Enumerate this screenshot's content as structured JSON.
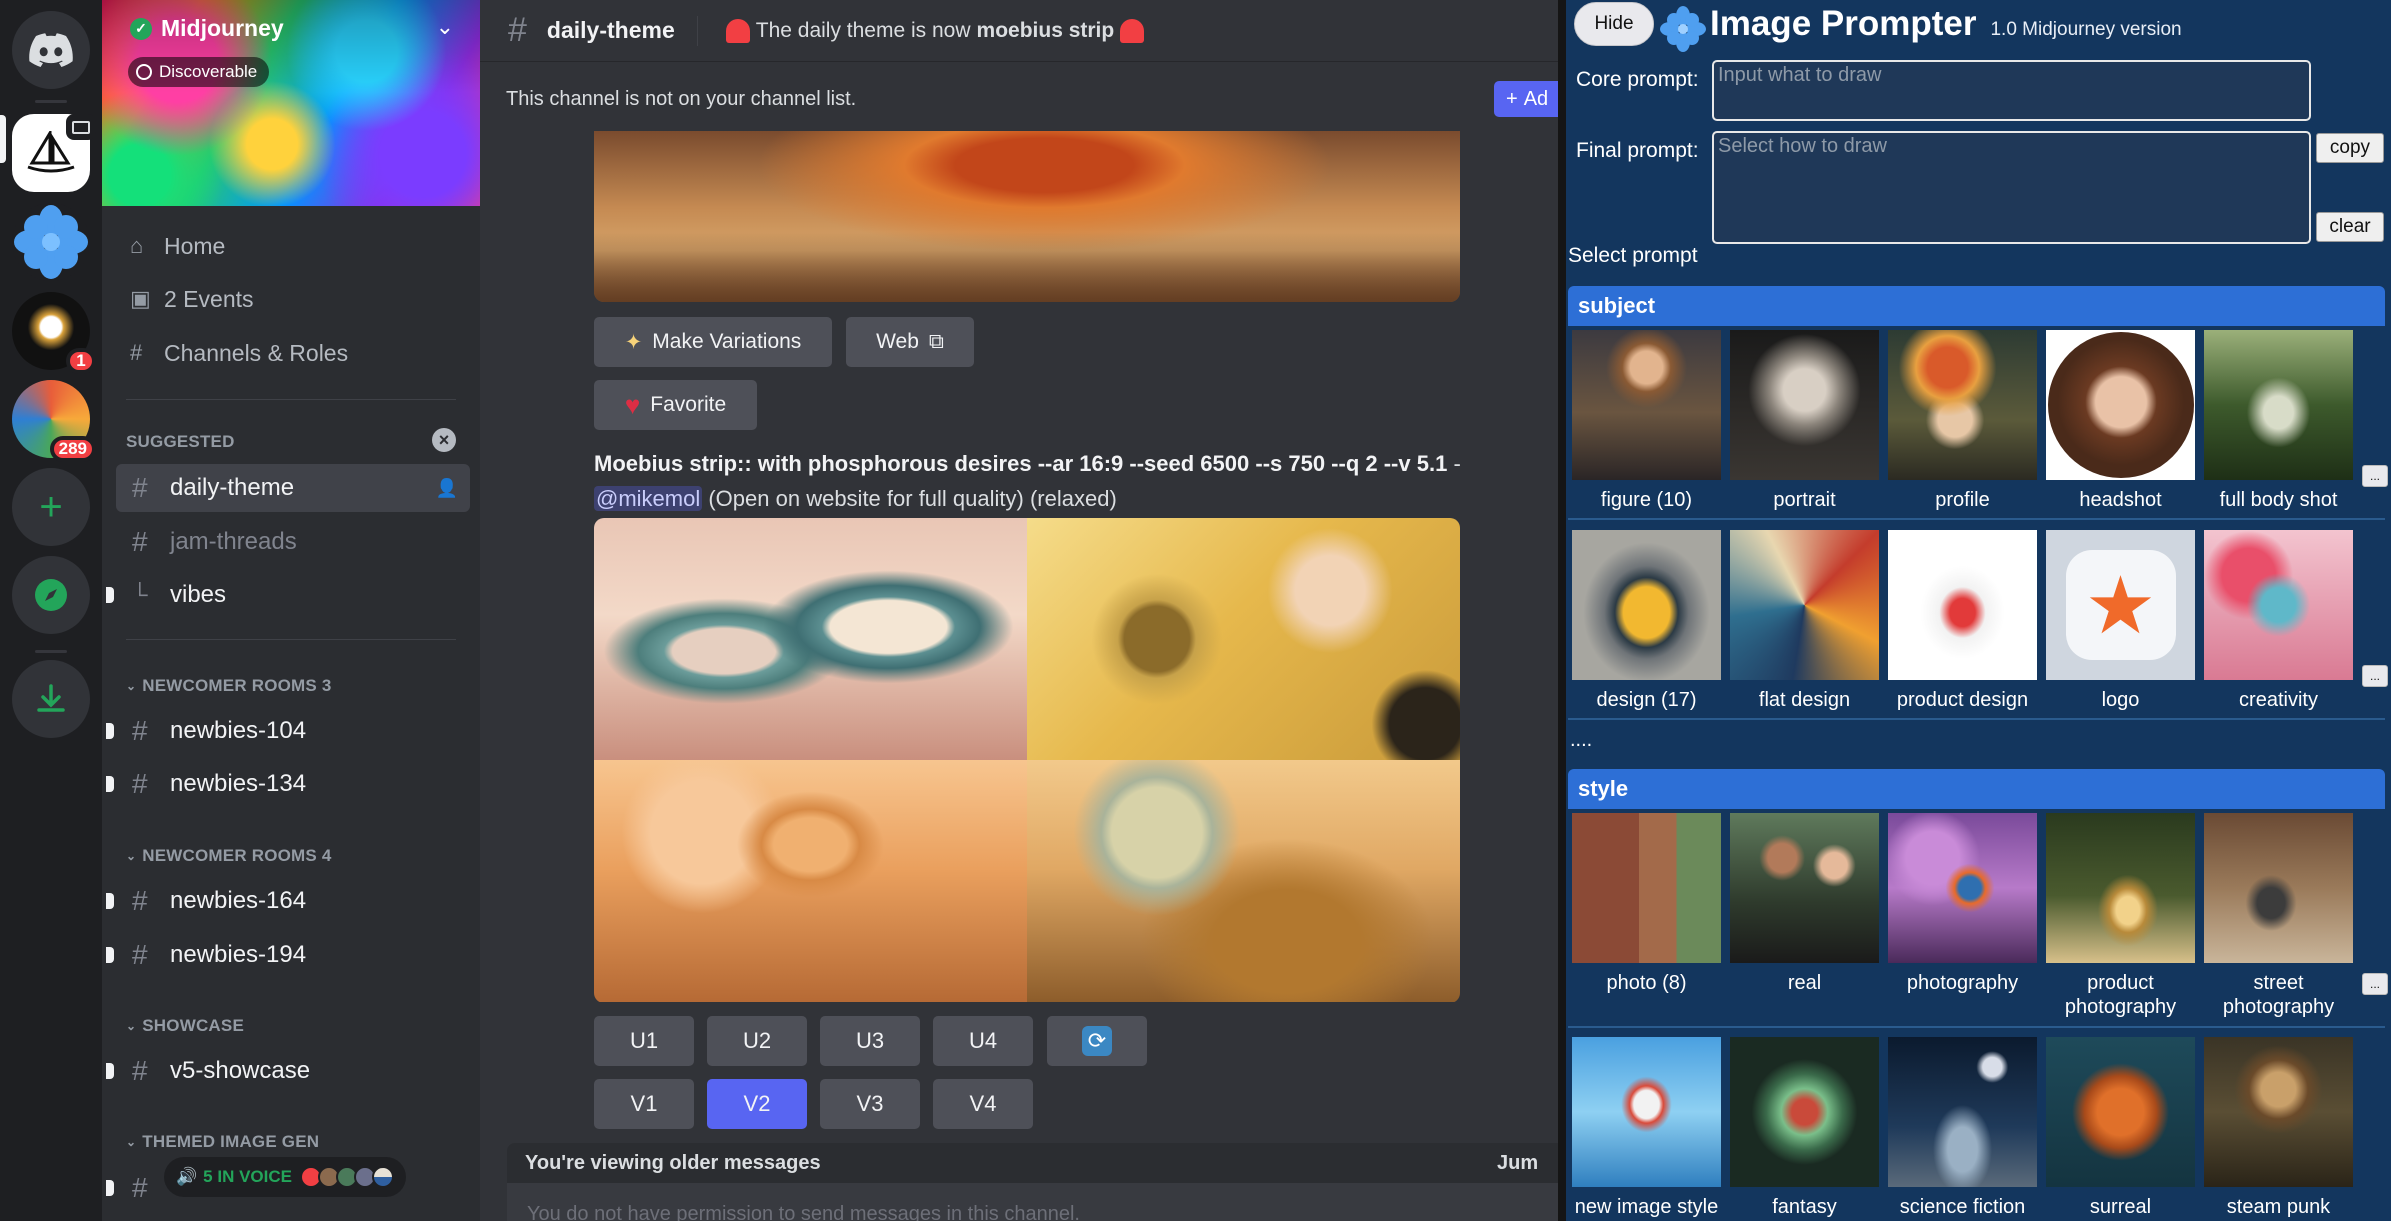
{
  "server": {
    "name": "Midjourney",
    "discoverable": "Discoverable"
  },
  "rail": {
    "badge_1": "1",
    "badge_289": "289"
  },
  "nav": {
    "home": "Home",
    "events": "2 Events",
    "channels_roles": "Channels & Roles"
  },
  "sidebar": {
    "suggested": "SUGGESTED",
    "daily_theme": "daily-theme",
    "jam_threads": "jam-threads",
    "vibes": "vibes",
    "newcomer3": "NEWCOMER ROOMS 3",
    "newbies_104": "newbies-104",
    "newbies_134": "newbies-134",
    "newcomer4": "NEWCOMER ROOMS 4",
    "newbies_164": "newbies-164",
    "newbies_194": "newbies-194",
    "showcase": "SHOWCASE",
    "v5_showcase": "v5-showcase",
    "themed": "THEMED IMAGE GEN",
    "voice": "5 IN VOICE"
  },
  "header": {
    "channel": "daily-theme",
    "topic_prefix": "The daily theme is now",
    "topic_bold": "moebius strip"
  },
  "notice": {
    "text": "This channel is not on your channel list.",
    "add": "Ad"
  },
  "message": {
    "make_variations": "Make Variations",
    "web": "Web",
    "favorite": "Favorite",
    "prompt_bold": "Moebius strip:: with phosphorous desires --ar 16:9 --seed 6500 --s 750 --q 2 --v 5.1",
    "dash": " -",
    "mention": "@mikemol",
    "suffix": "(Open on website for full quality) (relaxed)"
  },
  "buttons": {
    "u1": "U1",
    "u2": "U2",
    "u3": "U3",
    "u4": "U4",
    "v1": "V1",
    "v2": "V2",
    "v3": "V3",
    "v4": "V4"
  },
  "footer": {
    "older": "You're viewing older messages",
    "jump": "Jum",
    "composer": "You do not have permission to send messages in this channel."
  },
  "prompter": {
    "hide": "Hide",
    "title": "Image Prompter",
    "version": "1.0 Midjourney version",
    "core_label": "Core prompt:",
    "core_placeholder": "Input what to draw",
    "final_label": "Final prompt:",
    "final_placeholder": "Select how to draw",
    "copy": "copy",
    "clear": "clear",
    "select_prompt": "Select prompt",
    "more_button": "...",
    "subject_head": "subject",
    "subject_row1": [
      "figure (10)",
      "portrait",
      "profile",
      "headshot",
      "full body shot"
    ],
    "subject_row2": [
      "design (17)",
      "flat design",
      "product design",
      "logo",
      "creativity"
    ],
    "ellipsis": "....",
    "style_head": "style",
    "style_row1": [
      "photo (8)",
      "real",
      "photography",
      "product photography",
      "street photography"
    ],
    "style_row2": [
      "new image style",
      "fantasy",
      "science fiction",
      "surreal",
      "steam punk"
    ]
  },
  "colors": {
    "discord_bg": "#313338",
    "sidebar_bg": "#2b2d31",
    "rail_bg": "#1e1f22",
    "blurple": "#5865f2",
    "panel_bg": "#13365e",
    "section_head": "#2d6fd6"
  }
}
